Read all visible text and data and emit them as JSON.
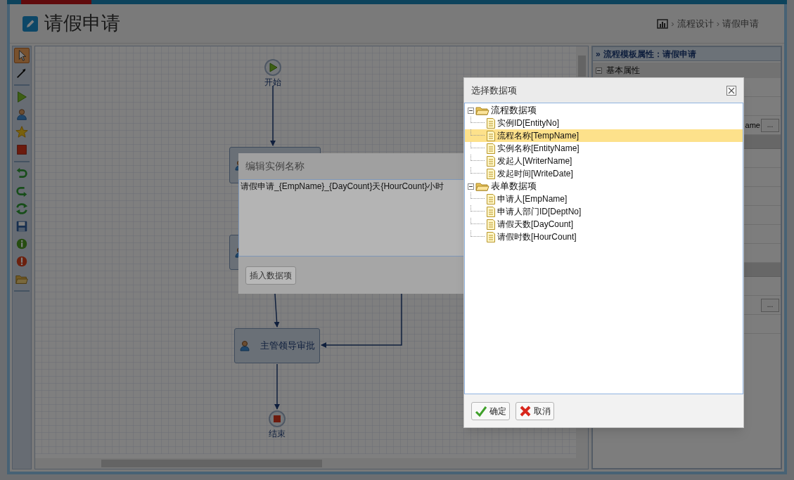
{
  "header": {
    "title": "请假申请",
    "breadcrumb": [
      {
        "separator": "›",
        "label": "流程设计"
      },
      {
        "separator": "›",
        "label": "请假申请"
      }
    ]
  },
  "toolbar": [
    {
      "kind": "pointer",
      "selected": true
    },
    {
      "kind": "connector",
      "selected": false
    },
    {
      "kind": "divider"
    },
    {
      "kind": "start",
      "selected": false
    },
    {
      "kind": "task",
      "selected": false
    },
    {
      "kind": "star",
      "selected": false
    },
    {
      "kind": "end",
      "selected": false
    },
    {
      "kind": "divider"
    },
    {
      "kind": "undo",
      "selected": false
    },
    {
      "kind": "redo",
      "selected": false
    },
    {
      "kind": "refresh",
      "selected": false
    },
    {
      "kind": "save",
      "selected": false
    },
    {
      "kind": "info",
      "selected": false
    },
    {
      "kind": "warning",
      "selected": false
    },
    {
      "kind": "open",
      "selected": false
    },
    {
      "kind": "divider"
    }
  ],
  "canvas": {
    "nodes": [
      {
        "kind": "start",
        "label": "开始"
      },
      {
        "kind": "task"
      },
      {
        "kind": "task"
      },
      {
        "kind": "task",
        "label": "主管领导审批"
      },
      {
        "kind": "end",
        "label": "结束"
      }
    ]
  },
  "properties_panel": {
    "chevron": "»",
    "title": "流程模板属性：请假申请",
    "section": "基本属性",
    "field_text": "ame",
    "browse_buttons": [
      "...",
      "..."
    ]
  },
  "edit_dialog": {
    "title": "编辑实例名称",
    "value": "请假申请_{EmpName}_{DayCount}天{HourCount}小时",
    "button": "插入数据项"
  },
  "select_dialog": {
    "title": "选择数据项",
    "tree": [
      {
        "label": "流程数据项",
        "expanded": true,
        "selected": false,
        "children": [
          {
            "label": "实例ID[EntityNo]",
            "selected": false
          },
          {
            "label": "流程名称[TempName]",
            "selected": true
          },
          {
            "label": "实例名称[EntityName]",
            "selected": false
          },
          {
            "label": "发起人[WriterName]",
            "selected": false
          },
          {
            "label": "发起时间[WriteDate]",
            "selected": false
          }
        ]
      },
      {
        "label": "表单数据项",
        "expanded": true,
        "selected": false,
        "children": [
          {
            "label": "申请人[EmpName]",
            "selected": false
          },
          {
            "label": "申请人部门ID[DeptNo]",
            "selected": false
          },
          {
            "label": "请假天数[DayCount]",
            "selected": false
          },
          {
            "label": "请假时数[HourCount]",
            "selected": false
          }
        ]
      }
    ],
    "buttons": [
      {
        "kind": "ok",
        "label": "确定"
      },
      {
        "kind": "cancel",
        "label": "取消"
      }
    ]
  }
}
